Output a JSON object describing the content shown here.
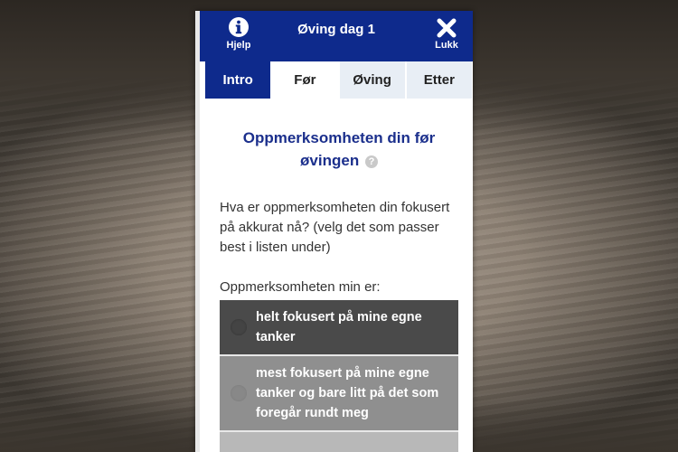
{
  "header": {
    "title": "Øving dag 1",
    "help_label": "Hjelp",
    "close_label": "Lukk",
    "help_icon": "info-circle-icon",
    "close_icon": "x-icon",
    "accent_color": "#0e2a8c"
  },
  "tabs": [
    {
      "label": "Intro"
    },
    {
      "label": "Før"
    },
    {
      "label": "Øving"
    },
    {
      "label": "Etter"
    }
  ],
  "content": {
    "section_title_line1": "Oppmerksomheten din før",
    "section_title_line2": "øvingen",
    "question": "Hva er oppmerksomheten din fokusert på akkurat nå? (velg det som passer best i listen under)",
    "answer_label": "Oppmerksomheten min er:",
    "options": [
      {
        "label": "helt fokusert på mine egne tanker"
      },
      {
        "label": "mest fokusert på mine egne tanker og bare litt på det som foregår rundt meg"
      },
      {
        "label": ""
      }
    ]
  }
}
